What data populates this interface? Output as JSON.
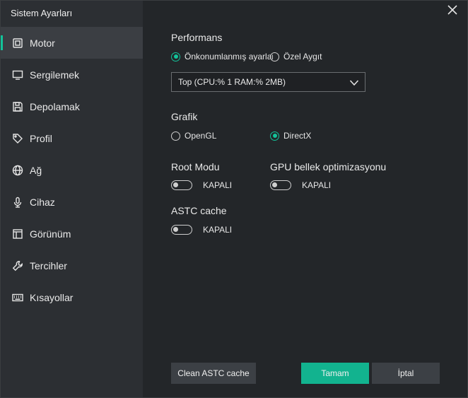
{
  "window": {
    "title": "Sistem Ayarları"
  },
  "sidebar": {
    "items": [
      {
        "label": "Motor",
        "icon": "chip-icon",
        "active": true
      },
      {
        "label": "Sergilemek",
        "icon": "monitor-icon",
        "active": false
      },
      {
        "label": "Depolamak",
        "icon": "save-icon",
        "active": false
      },
      {
        "label": "Profil",
        "icon": "tag-icon",
        "active": false
      },
      {
        "label": "Ağ",
        "icon": "globe-icon",
        "active": false
      },
      {
        "label": "Cihaz",
        "icon": "microphone-icon",
        "active": false
      },
      {
        "label": "Görünüm",
        "icon": "layout-icon",
        "active": false
      },
      {
        "label": "Tercihler",
        "icon": "wrench-icon",
        "active": false
      },
      {
        "label": "Kısayollar",
        "icon": "keyboard-icon",
        "active": false
      }
    ]
  },
  "performance": {
    "title": "Performans",
    "option_preset": "Önkonumlanmış ayarlar",
    "option_custom": "Özel Aygıt",
    "selected_value": "Top (CPU:% 1 RAM:% 2MB)"
  },
  "graphics": {
    "title": "Grafik",
    "option_opengl": "OpenGL",
    "option_directx": "DirectX"
  },
  "root_mode": {
    "title": "Root Modu",
    "state": "KAPALI"
  },
  "gpu_opt": {
    "title": "GPU bellek optimizasyonu",
    "state": "KAPALI"
  },
  "astc": {
    "title": "ASTC cache",
    "state": "KAPALI"
  },
  "buttons": {
    "clean": "Clean ASTC cache",
    "ok": "Tamam",
    "cancel": "İptal"
  },
  "colors": {
    "accent": "#13c39a",
    "sidebar_bg": "#2c2f33",
    "content_bg": "#232629"
  }
}
